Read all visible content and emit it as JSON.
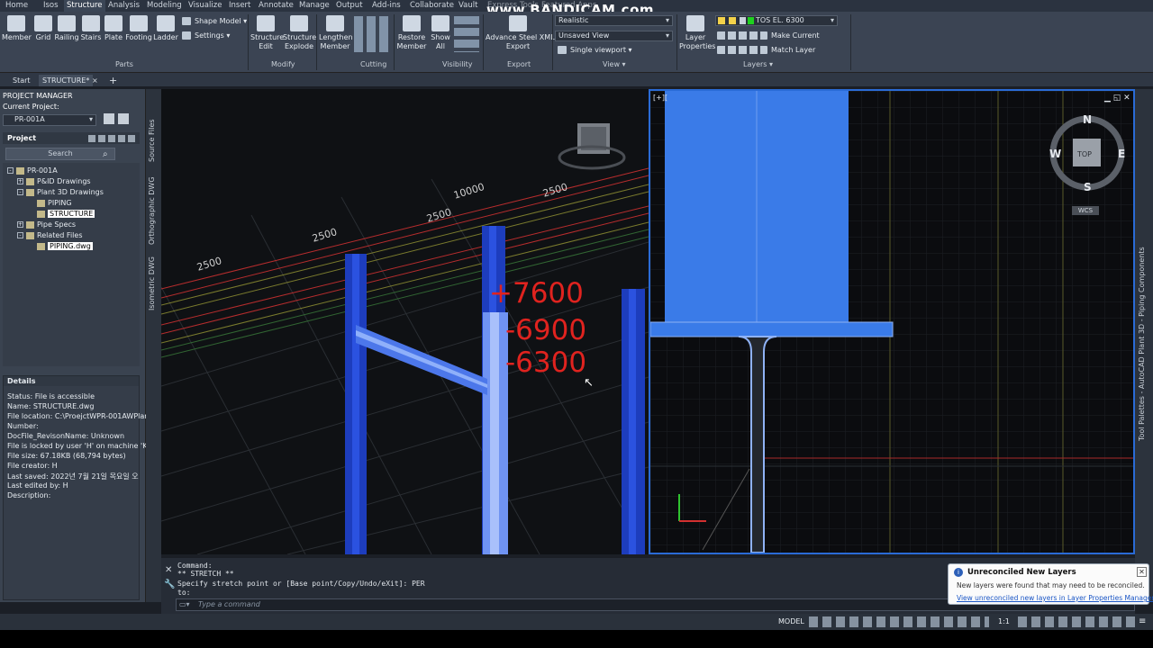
{
  "menubar": {
    "items": [
      "Home",
      "Isos",
      "Structure",
      "Analysis",
      "Modeling",
      "Visualize",
      "Insert",
      "Annotate",
      "Manage",
      "Output",
      "Add-ins",
      "Collaborate",
      "Vault",
      "Express Tools",
      "Featured Apps"
    ],
    "active": "Structure"
  },
  "watermark": "www.BANDICAM.com",
  "ribbon": {
    "parts_buttons": [
      "Member",
      "Grid",
      "Railing",
      "Stairs",
      "Plate",
      "Footing",
      "Ladder"
    ],
    "shape_model": "Shape Model",
    "settings": "Settings",
    "parts_title": "Parts",
    "modify_buttons": [
      {
        "l1": "Structure",
        "l2": "Edit"
      },
      {
        "l1": "Structure",
        "l2": "Explode"
      }
    ],
    "modify_title": "Modify",
    "cutting_buttons": [
      {
        "l1": "Lengthen",
        "l2": "Member"
      }
    ],
    "cutting_title": "Cutting",
    "visibility_buttons": [
      {
        "l1": "Restore",
        "l2": "Member"
      },
      {
        "l1": "Show",
        "l2": "All"
      }
    ],
    "visibility_title": "Visibility",
    "export_button": {
      "l1": "Advance Steel XML",
      "l2": "Export"
    },
    "export_title": "Export",
    "view_style": "Realistic",
    "view_saved": "Unsaved View",
    "viewport": "Single viewport",
    "view_title": "View",
    "layer_properties": {
      "l1": "Layer",
      "l2": "Properties"
    },
    "layer_current": "TOS EL. 6300",
    "make_current": "Make Current",
    "match_layer": "Match Layer",
    "layers_title": "Layers"
  },
  "tabs": {
    "start": "Start",
    "active": "STRUCTURE*",
    "close": "×",
    "add": "+"
  },
  "project_manager": {
    "title": "PROJECT MANAGER",
    "current_project_label": "Current Project:",
    "current_project": "PR-001A",
    "project_label": "Project",
    "search_placeholder": "Search",
    "tree": [
      {
        "label": "PR-001A",
        "indent": 0
      },
      {
        "label": "P&ID Drawings",
        "indent": 1
      },
      {
        "label": "Plant 3D Drawings",
        "indent": 1
      },
      {
        "label": "PIPING",
        "indent": 2
      },
      {
        "label": "STRUCTURE",
        "indent": 2,
        "selected": true
      },
      {
        "label": "Pipe Specs",
        "indent": 1
      },
      {
        "label": "Related Files",
        "indent": 1
      },
      {
        "label": "PIPING.dwg",
        "indent": 2,
        "selected": true
      }
    ],
    "side_tabs": [
      "Source Files",
      "Orthographic DWG",
      "Isometric DWG"
    ]
  },
  "details": {
    "title": "Details",
    "lines": [
      "Status: File is accessible",
      "Name:  STRUCTURE.dwg",
      "File location:  C:\\ProejctWPR-001AWPlan",
      "Number:",
      "DocFile_RevisonName:  Unknown",
      "File is locked by user 'H' on machine 'K",
      "File size: 67.18KB (68,794 bytes)",
      "File creator: H",
      "Last saved: 2022년 7월 21일 목요일 오",
      "Last edited by: H",
      "Description:"
    ]
  },
  "viewport3d": {
    "elevations": [
      "+7600",
      "-6900",
      "-6300"
    ],
    "dimensions": [
      "10000",
      "2500",
      "2500",
      "2500",
      "2500"
    ]
  },
  "viewport2d": {
    "label": "[+][",
    "compass": {
      "n": "N",
      "s": "S",
      "e": "E",
      "w": "W",
      "top": "TOP",
      "wcs": "WCS"
    }
  },
  "right_palette": "Tool Palettes - AutoCAD Plant 3D - Piping Components",
  "command": {
    "lines": [
      "Command:",
      "** STRETCH **",
      "Specify stretch point or [Base point/Copy/Undo/eXit]: PER",
      "to:"
    ],
    "placeholder": "Type a command"
  },
  "notification": {
    "title": "Unreconciled New Layers",
    "body": "New layers were found that may need to be reconciled.",
    "link": "View unreconciled new layers in Layer Properties Manager"
  },
  "status": {
    "model": "MODEL",
    "scale": "1:1"
  },
  "colors": {
    "accent": "#2a6bd6",
    "elevation": "#e0231f",
    "beam": "#3a7be8"
  }
}
